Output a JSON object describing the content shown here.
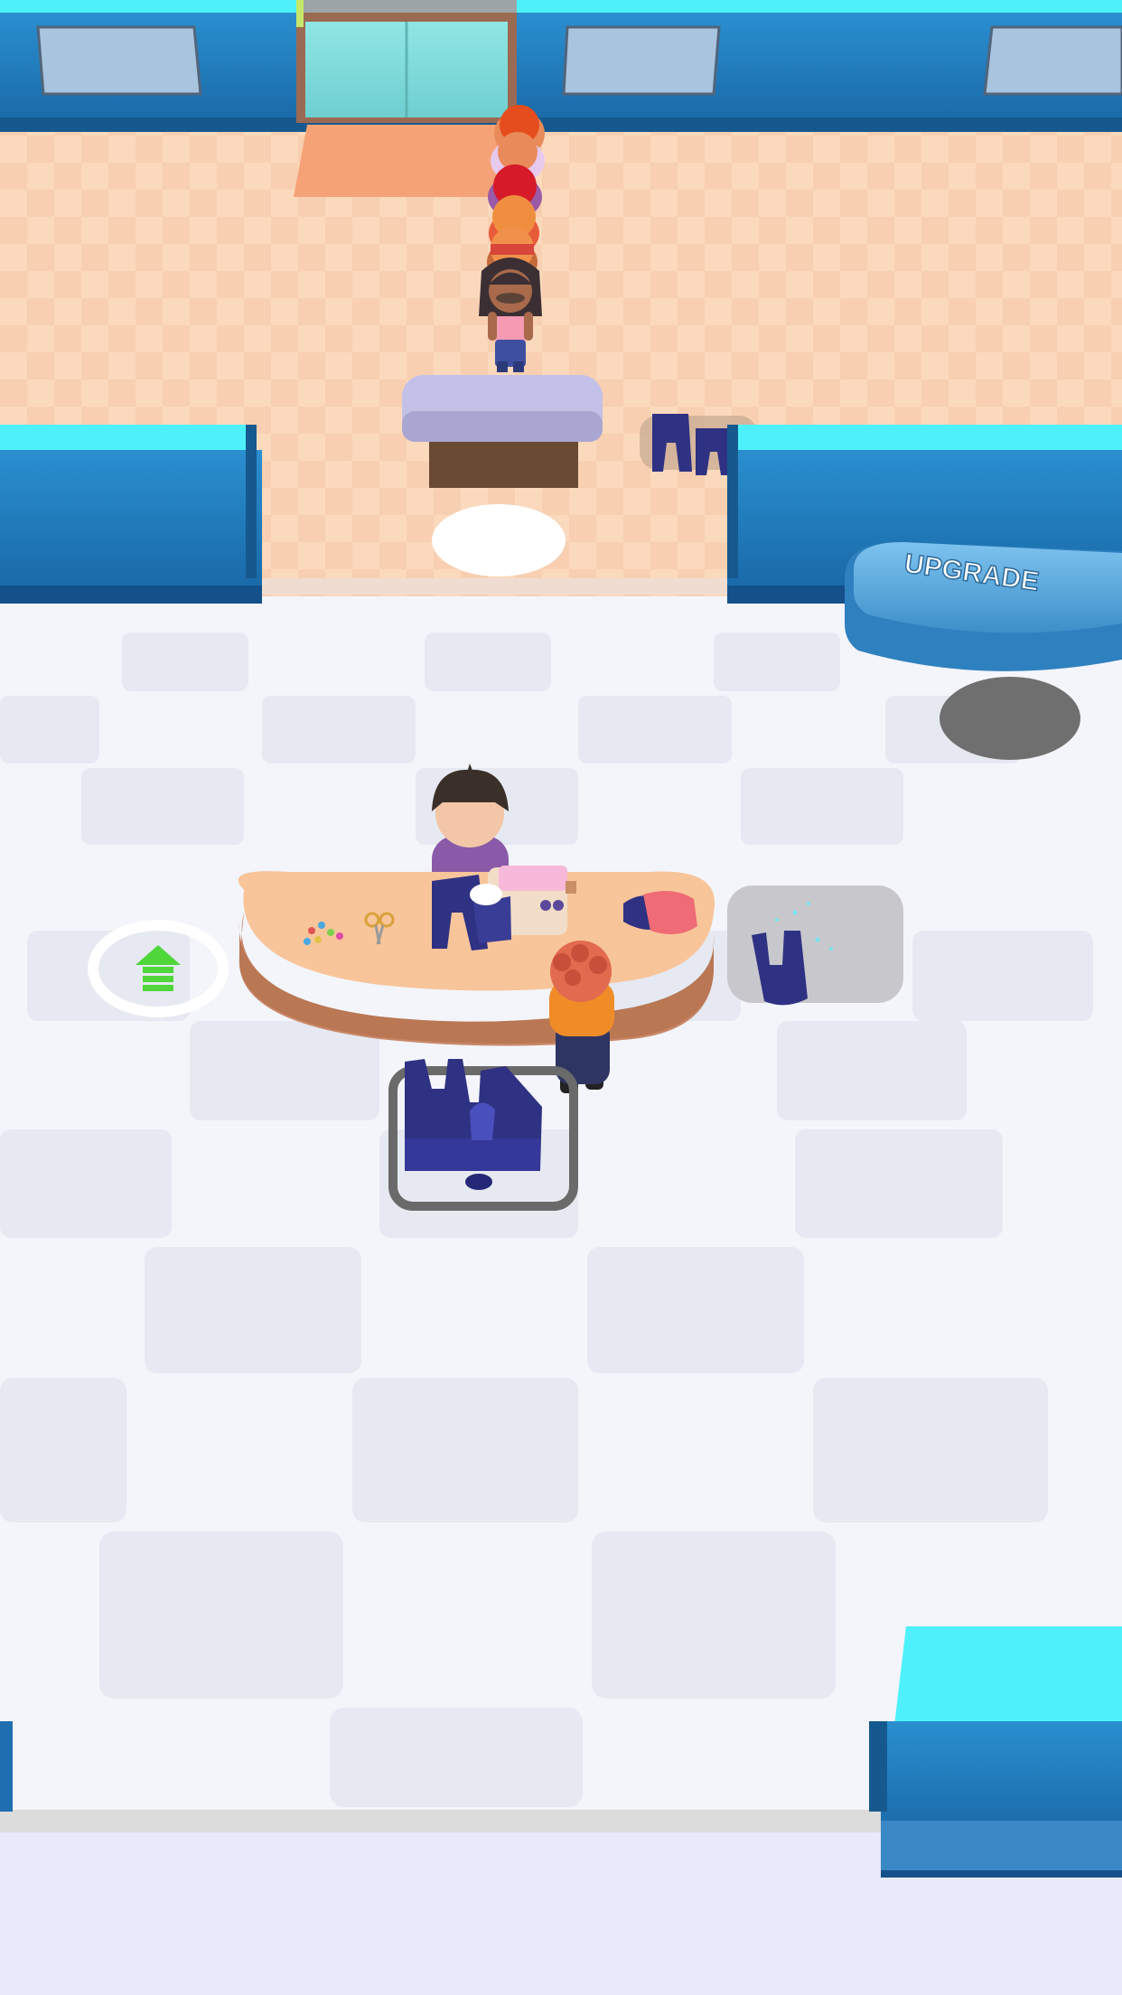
{
  "game": {
    "upgrade_sign": "UPGRADE"
  },
  "colors": {
    "wall_blue": "#1f7fc0",
    "wall_top_cyan": "#4ef1fb",
    "shop_floor": "#fbd9bd",
    "work_floor": "#f3f5fb",
    "counter": "#f8c59a",
    "clothing_navy": "#2a2c82",
    "upgrade_arrow": "#4fd63a"
  },
  "icons": {
    "upgrade_zone": "green-up-arrow-icon",
    "sewing_machine": "sewing-machine-icon"
  },
  "queue": {
    "customer_count": 6
  }
}
